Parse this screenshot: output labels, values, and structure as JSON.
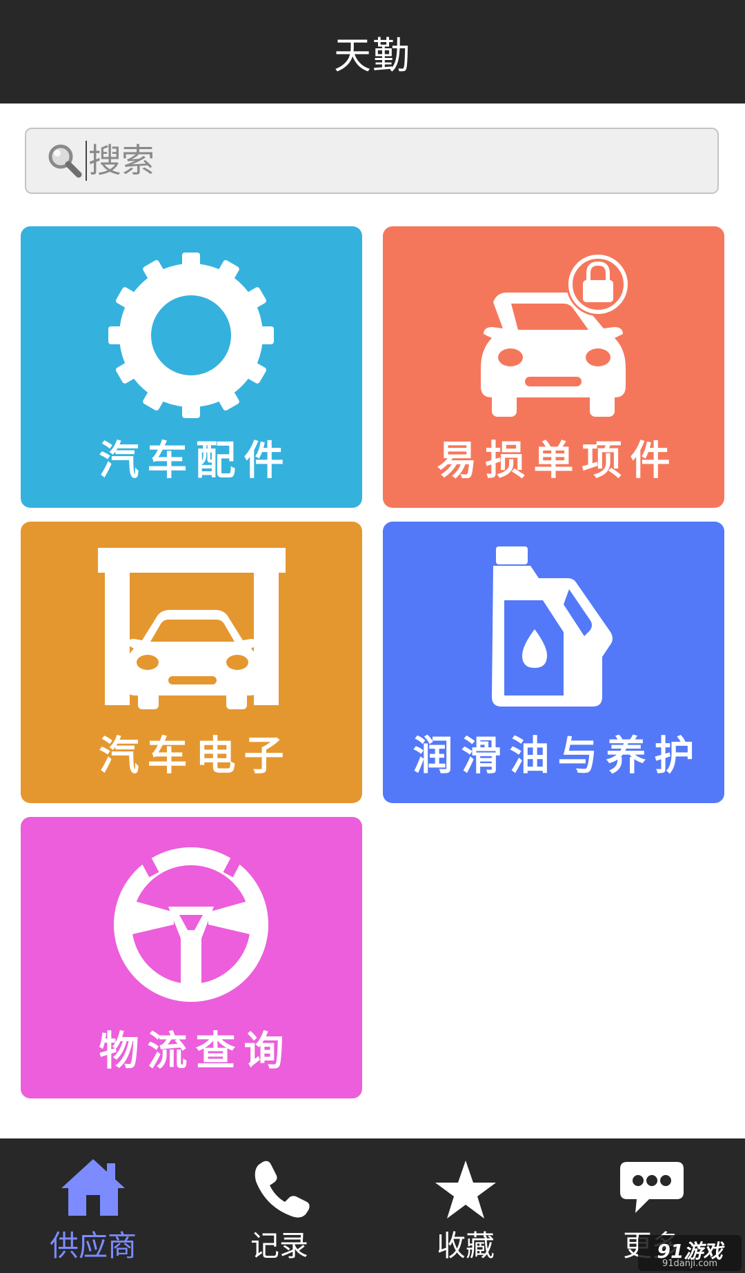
{
  "header": {
    "title": "天勤"
  },
  "search": {
    "placeholder": "搜索",
    "value": ""
  },
  "categories": [
    {
      "label": "汽车配件",
      "icon": "tire-icon",
      "color": "#35b1de"
    },
    {
      "label": "易损单项件",
      "icon": "car-lock-icon",
      "color": "#f5775b"
    },
    {
      "label": "汽车电子",
      "icon": "car-garage-icon",
      "color": "#e5972f"
    },
    {
      "label": "润滑油与养护",
      "icon": "oil-bottle-icon",
      "color": "#5379f8"
    },
    {
      "label": "物流查询",
      "icon": "steering-wheel-icon",
      "color": "#ec5edb"
    }
  ],
  "bottom_nav": {
    "items": [
      {
        "label": "供应商",
        "icon": "home-icon",
        "active": true
      },
      {
        "label": "记录",
        "icon": "phone-icon",
        "active": false
      },
      {
        "label": "收藏",
        "icon": "star-icon",
        "active": false
      },
      {
        "label": "更多",
        "icon": "chat-bubble-icon",
        "active": false
      }
    ],
    "active_color": "#7c8cff"
  },
  "watermark": {
    "main": "91游戏",
    "sub": "91danji.com"
  }
}
